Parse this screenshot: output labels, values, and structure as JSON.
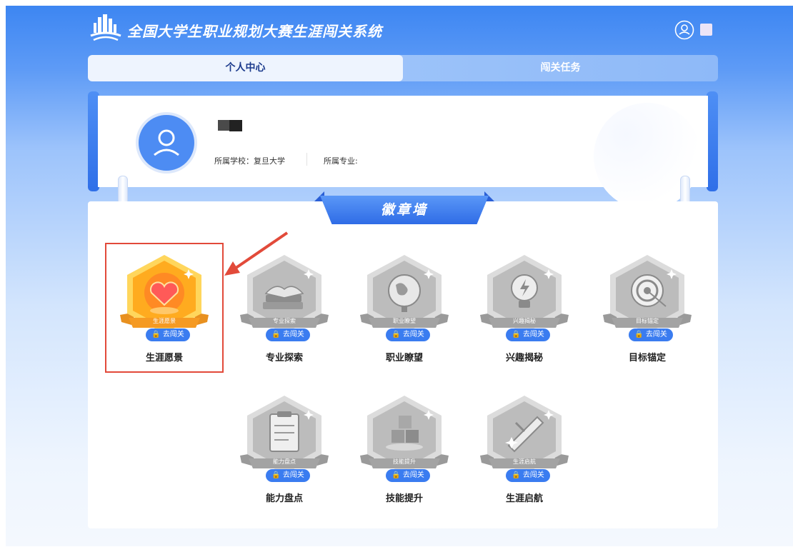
{
  "header": {
    "title": "全国大学生职业规划大赛生涯闯关系统"
  },
  "tabs": [
    {
      "label": "个人中心",
      "active": true
    },
    {
      "label": "闯关任务",
      "active": false
    }
  ],
  "profile": {
    "school_label": "所属学校：复旦大学",
    "major_label": "所属专业:"
  },
  "badge_wall": {
    "title": "徽章墙",
    "badges": [
      {
        "name": "生涯愿景",
        "caption": "生涯愿景",
        "button": "去闯关",
        "unlocked": true,
        "icon": "heart-icon"
      },
      {
        "name": "专业探索",
        "caption": "专业探索",
        "button": "去闯关",
        "unlocked": false,
        "icon": "books-icon"
      },
      {
        "name": "职业瞭望",
        "caption": "职业瞭望",
        "button": "去闯关",
        "unlocked": false,
        "icon": "globe-icon"
      },
      {
        "name": "兴趣揭秘",
        "caption": "兴趣揭秘",
        "button": "去闯关",
        "unlocked": false,
        "icon": "lightbulb-icon"
      },
      {
        "name": "目标锚定",
        "caption": "目标锚定",
        "button": "去闯关",
        "unlocked": false,
        "icon": "target-icon"
      },
      {
        "name": "能力盘点",
        "caption": "能力盘点",
        "button": "去闯关",
        "unlocked": false,
        "icon": "clipboard-icon"
      },
      {
        "name": "技能提升",
        "caption": "技能提升",
        "button": "去闯关",
        "unlocked": false,
        "icon": "blocks-icon"
      },
      {
        "name": "生涯启航",
        "caption": "生涯启航",
        "button": "去闯关",
        "unlocked": false,
        "icon": "rocket-icon"
      }
    ]
  },
  "colors": {
    "accent": "#3a7cf0",
    "highlight_border": "#e24a3a",
    "unlocked_badge": "#ffb11f",
    "locked_badge": "#b9b9b9"
  }
}
